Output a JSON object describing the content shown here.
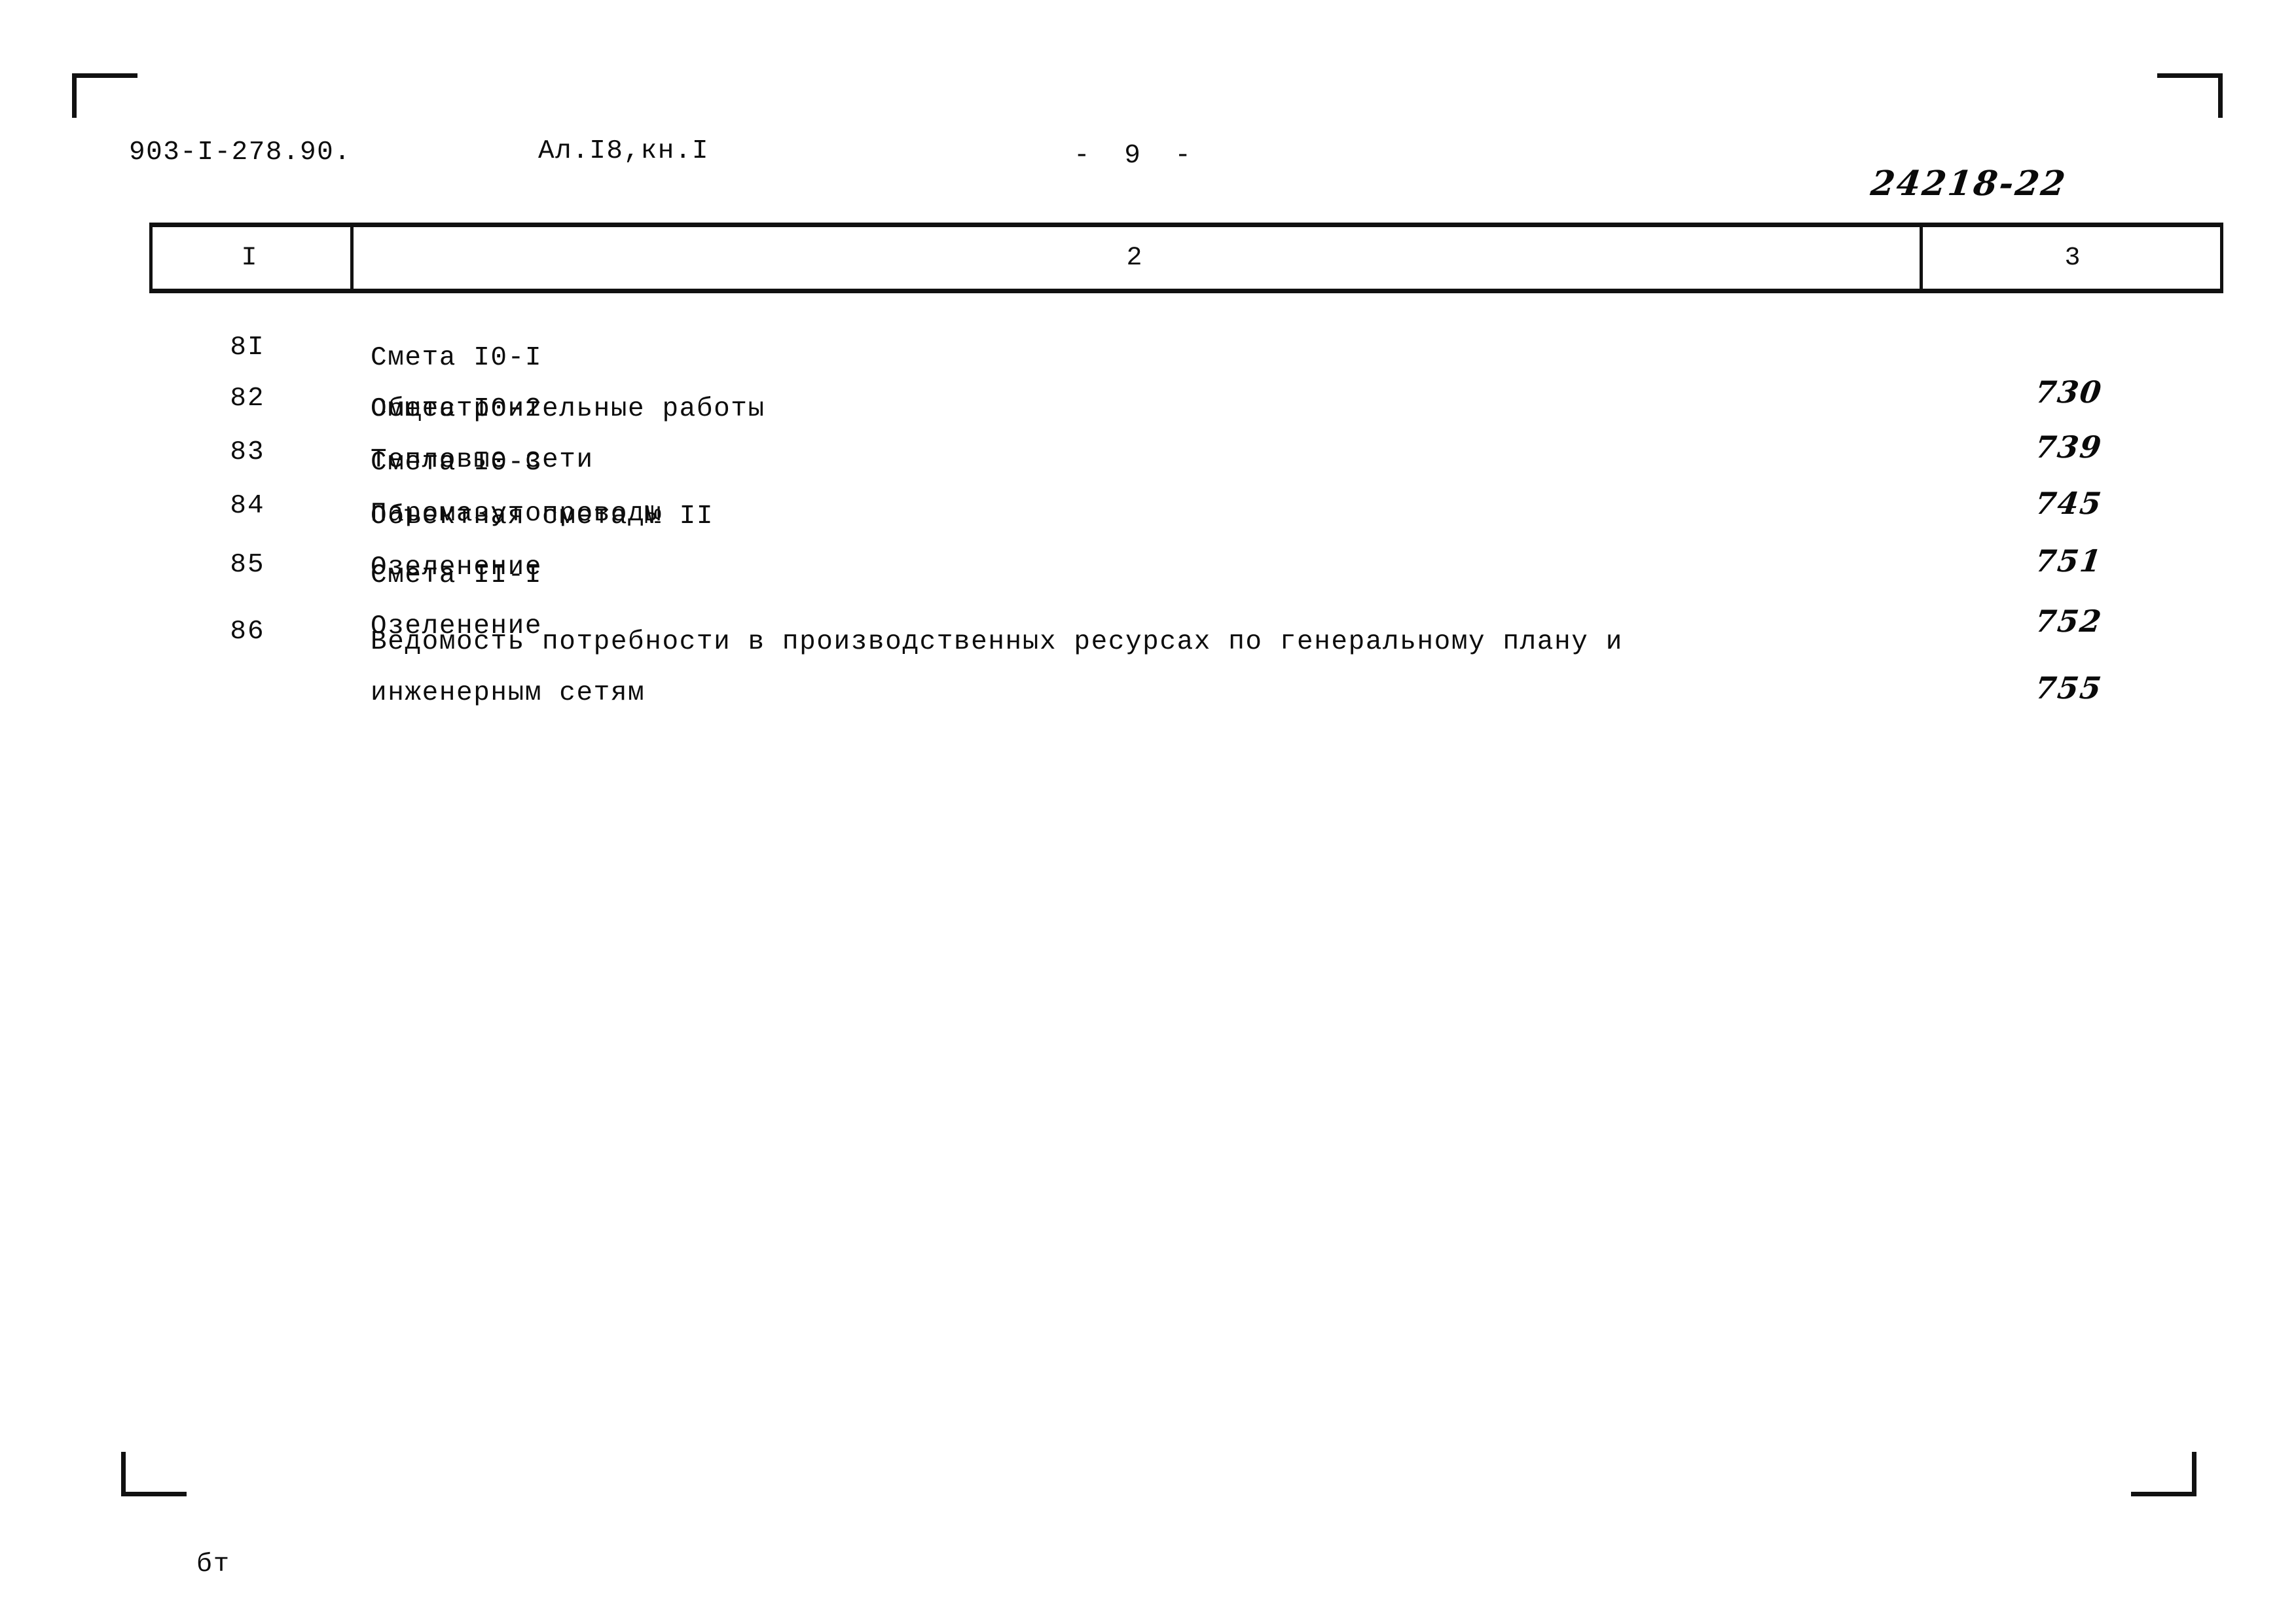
{
  "header": {
    "doc_code": "903-I-278.90.",
    "album_ref": "Ал.I8,кн.I",
    "page_number": "- 9 -",
    "archive_stamp": "24218-22"
  },
  "table": {
    "columns": [
      {
        "label": "I"
      },
      {
        "label": "2"
      },
      {
        "label": "3"
      }
    ],
    "rows": [
      {
        "num": "8I",
        "line1": "Смета I0-I",
        "line2": "Общестроительные работы",
        "page": "730"
      },
      {
        "num": "82",
        "line1": "Смета I0-2",
        "line2": "Тепловые сети",
        "page": "739"
      },
      {
        "num": "83",
        "line1": "Смета I0-3",
        "line2": "Паромазутопроводы",
        "page": "745"
      },
      {
        "num": "84",
        "line1": "Объектная смета № II",
        "line2": "Озеленение",
        "page": "751"
      },
      {
        "num": "85",
        "line1": "Смета II-I",
        "line2": "Озеленение",
        "page": "752"
      },
      {
        "num": "86",
        "line1": "Ведомость потребности в производственных ресурсах по генеральному плану и",
        "line2": "инженерным сетям",
        "page": "755"
      }
    ]
  },
  "footer": {
    "mark": "бт"
  }
}
